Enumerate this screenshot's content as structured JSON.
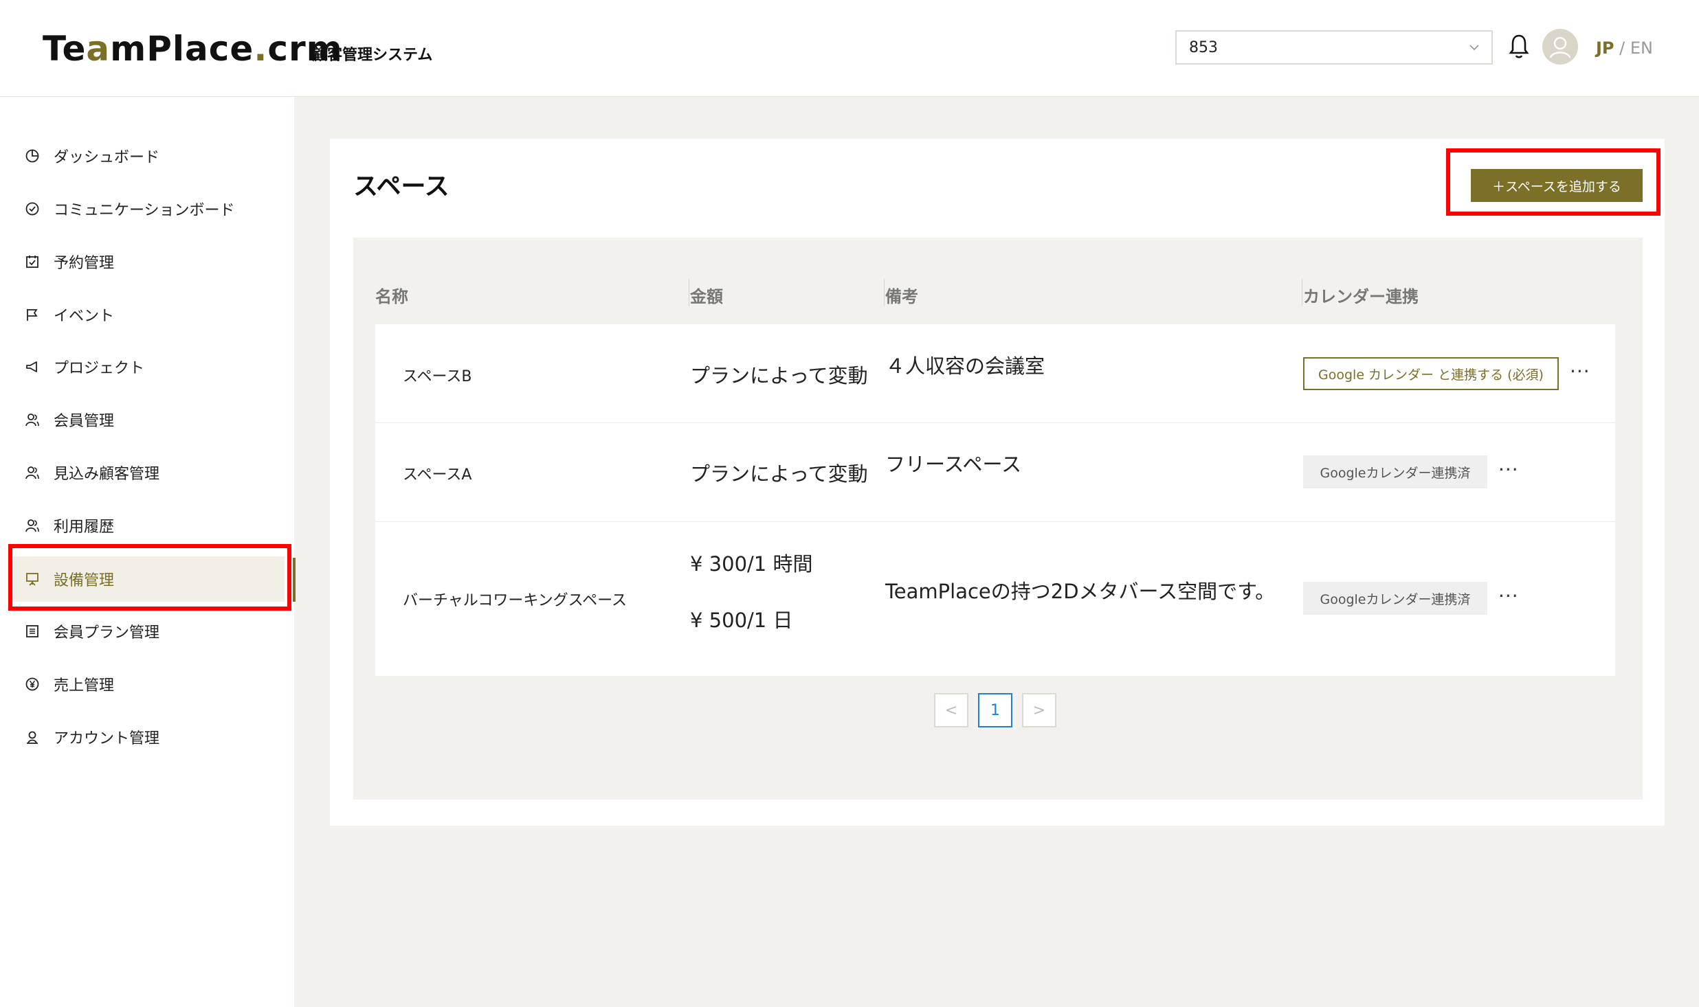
{
  "header": {
    "logo_prefix": "Te",
    "logo_a": "a",
    "logo_mid": "mPlace",
    "logo_dot": ".",
    "logo_suffix": "crm",
    "subtitle": "顧客管理システム",
    "space_select": "853",
    "lang_jp": "JP",
    "lang_sep": " / ",
    "lang_en": "EN"
  },
  "sidebar": {
    "items": [
      {
        "label": "ダッシュボード",
        "icon": "pie-chart-icon"
      },
      {
        "label": "コミュニケーションボード",
        "icon": "check-circle-icon"
      },
      {
        "label": "予約管理",
        "icon": "calendar-check-icon"
      },
      {
        "label": "イベント",
        "icon": "flag-icon"
      },
      {
        "label": "プロジェクト",
        "icon": "megaphone-icon"
      },
      {
        "label": "会員管理",
        "icon": "users-icon"
      },
      {
        "label": "見込み顧客管理",
        "icon": "users-icon"
      },
      {
        "label": "利用履歴",
        "icon": "users-icon"
      },
      {
        "label": "設備管理",
        "icon": "presentation-board-icon",
        "active": true
      },
      {
        "label": "会員プラン管理",
        "icon": "list-icon"
      },
      {
        "label": "売上管理",
        "icon": "yen-circle-icon"
      },
      {
        "label": "アカウント管理",
        "icon": "account-icon"
      }
    ]
  },
  "main": {
    "title": "スペース",
    "add_button": "＋スペースを追加する",
    "columns": [
      "名称",
      "金額",
      "備考",
      "カレンダー連携"
    ],
    "rows": [
      {
        "name": "スペースB",
        "price": "プランによって変動",
        "note": "４人収容の会議室",
        "calendar": "Google カレンダー と連携する (必須)",
        "calendar_state": "connect"
      },
      {
        "name": "スペースA",
        "price": "プランによって変動",
        "note": "フリースペース",
        "calendar": "Googleカレンダー連携済",
        "calendar_state": "connected"
      },
      {
        "name": "バーチャルコワーキングスペース",
        "price_line1": "¥ 300/1 時間",
        "price_line2": "¥ 500/1 日",
        "note": "TeamPlaceの持つ2Dメタバース空間です。",
        "calendar": "Googleカレンダー連携済",
        "calendar_state": "connected"
      }
    ],
    "more_label": "···",
    "pagination": {
      "prev": "<",
      "current": "1",
      "next": ">"
    }
  },
  "colors": {
    "accent": "#7c6f27",
    "highlight": "#ff0000",
    "page_bg": "#f2f1ed",
    "link_blue": "#1f7fd6"
  }
}
